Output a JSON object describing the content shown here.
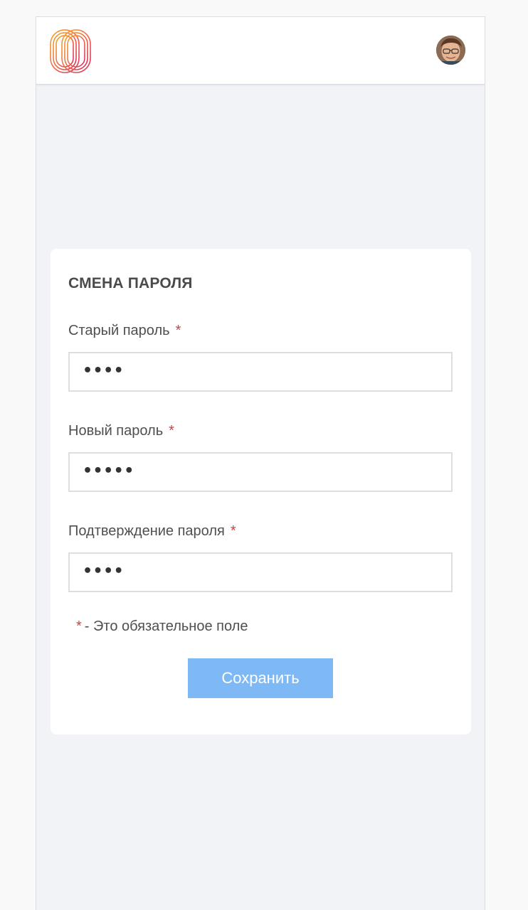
{
  "app": {
    "logo_name": "brand-logo",
    "avatar_name": "user-avatar"
  },
  "card": {
    "title": "СМЕНА ПАРОЛЯ",
    "required_mark": "*",
    "fields": [
      {
        "label": "Старый пароль",
        "masked_value": "••••"
      },
      {
        "label": "Новый пароль",
        "masked_value": "•••••"
      },
      {
        "label": "Подтверждение пароля",
        "masked_value": "••••"
      }
    ],
    "required_note": "- Это обязательное поле",
    "save_label": "Сохранить"
  },
  "colors": {
    "accent": "#7fb9f5",
    "required": "#b84a4a",
    "page_bg": "#f2f3f7"
  }
}
